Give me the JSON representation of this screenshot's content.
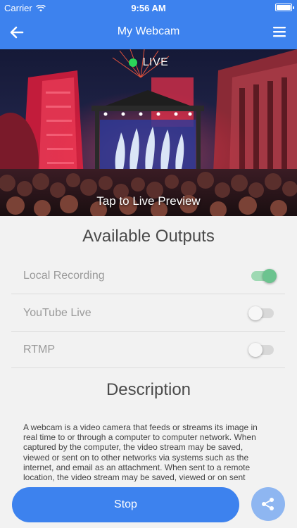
{
  "status_bar": {
    "carrier": "Carrier",
    "time": "9:56 AM"
  },
  "nav": {
    "title": "My Webcam",
    "back_icon": "arrow-left-icon",
    "menu_icon": "hamburger-menu-icon"
  },
  "preview": {
    "live_label": "LIVE",
    "tap_label": "Tap to Live Preview"
  },
  "outputs": {
    "title": "Available Outputs",
    "items": [
      {
        "label": "Local Recording",
        "enabled": true
      },
      {
        "label": "YouTube Live",
        "enabled": false
      },
      {
        "label": "RTMP",
        "enabled": false
      }
    ]
  },
  "description": {
    "title": "Description",
    "text": "A webcam is a video camera that feeds or streams its image in real time to or through a computer to computer network. When captured by the computer, the video stream may be saved, viewed or sent on to other networks via systems such as the internet, and email as an attachment. When sent to a remote location, the video stream may be saved, viewed or on sent there."
  },
  "actions": {
    "stop_label": "Stop",
    "share_icon": "share-icon"
  },
  "colors": {
    "primary": "#3d82ee",
    "live": "#2bd45a",
    "toggle_on": "#6cc38f",
    "share_bg": "#8eb6f1"
  }
}
